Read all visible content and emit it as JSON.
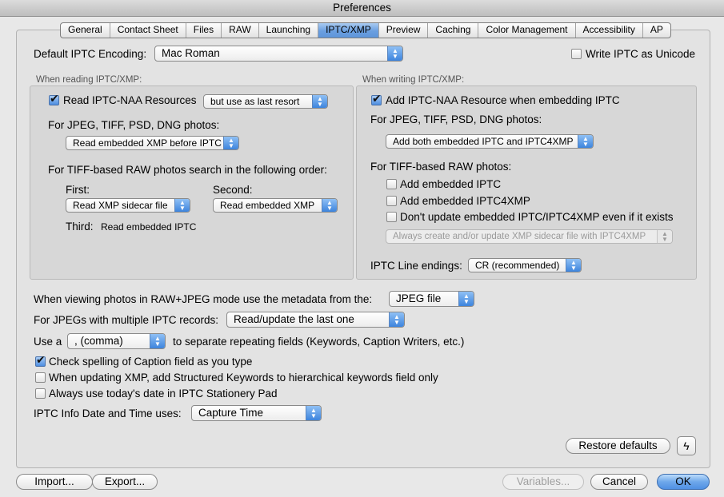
{
  "window": {
    "title": "Preferences"
  },
  "tabs": [
    "General",
    "Contact Sheet",
    "Files",
    "RAW",
    "Launching",
    "IPTC/XMP",
    "Preview",
    "Caching",
    "Color Management",
    "Accessibility",
    "AP"
  ],
  "active_tab": "IPTC/XMP",
  "encoding": {
    "label": "Default IPTC Encoding:",
    "value": "Mac Roman",
    "unicode_label": "Write IPTC as Unicode",
    "unicode_checked": false
  },
  "reading": {
    "title": "When reading IPTC/XMP:",
    "read_naa_label": "Read IPTC-NAA Resources",
    "read_naa_checked": true,
    "read_naa_option": "but use as last resort",
    "jpeg_label": "For JPEG, TIFF, PSD, DNG photos:",
    "jpeg_option": "Read embedded XMP before IPTC",
    "tiff_label": "For TIFF-based RAW photos search in the following order:",
    "first_label": "First:",
    "first_value": "Read XMP sidecar file",
    "second_label": "Second:",
    "second_value": "Read embedded XMP",
    "third_label": "Third:",
    "third_value": "Read embedded IPTC"
  },
  "writing": {
    "title": "When writing IPTC/XMP:",
    "add_naa_label": "Add IPTC-NAA Resource when embedding IPTC",
    "add_naa_checked": true,
    "jpeg_label": "For JPEG, TIFF, PSD, DNG photos:",
    "jpeg_option": "Add both embedded IPTC and IPTC4XMP",
    "tiff_label": "For TIFF-based RAW photos:",
    "opt_iptc": "Add embedded IPTC",
    "opt_iptc4xmp": "Add embedded IPTC4XMP",
    "opt_dont_update": "Don't update embedded IPTC/IPTC4XMP even if it exists",
    "sidecar_option": "Always create and/or update XMP sidecar file with IPTC4XMP",
    "line_endings_label": "IPTC Line endings:",
    "line_endings_value": "CR (recommended)"
  },
  "bottom": {
    "rawjpeg_label": "When viewing photos in RAW+JPEG mode use the metadata from the:",
    "rawjpeg_value": "JPEG file",
    "multi_label": "For JPEGs with multiple IPTC records:",
    "multi_value": "Read/update the last one",
    "sep_prefix": "Use a",
    "sep_value": ", (comma)",
    "sep_suffix": "to separate repeating fields (Keywords, Caption Writers, etc.)",
    "spell_label": "Check spelling of Caption field as you type",
    "spell_checked": true,
    "structured_label": "When updating XMP, add Structured Keywords to hierarchical keywords field only",
    "today_label": "Always use today's date in IPTC Stationery Pad",
    "date_label": "IPTC Info Date and Time uses:",
    "date_value": "Capture Time",
    "restore_label": "Restore defaults"
  },
  "footer": {
    "import_label": "Import...",
    "export_label": "Export...",
    "variables_label": "Variables...",
    "cancel_label": "Cancel",
    "ok_label": "OK"
  },
  "colors": {
    "accent": "#5e95da",
    "background": "#e8e8e8"
  }
}
